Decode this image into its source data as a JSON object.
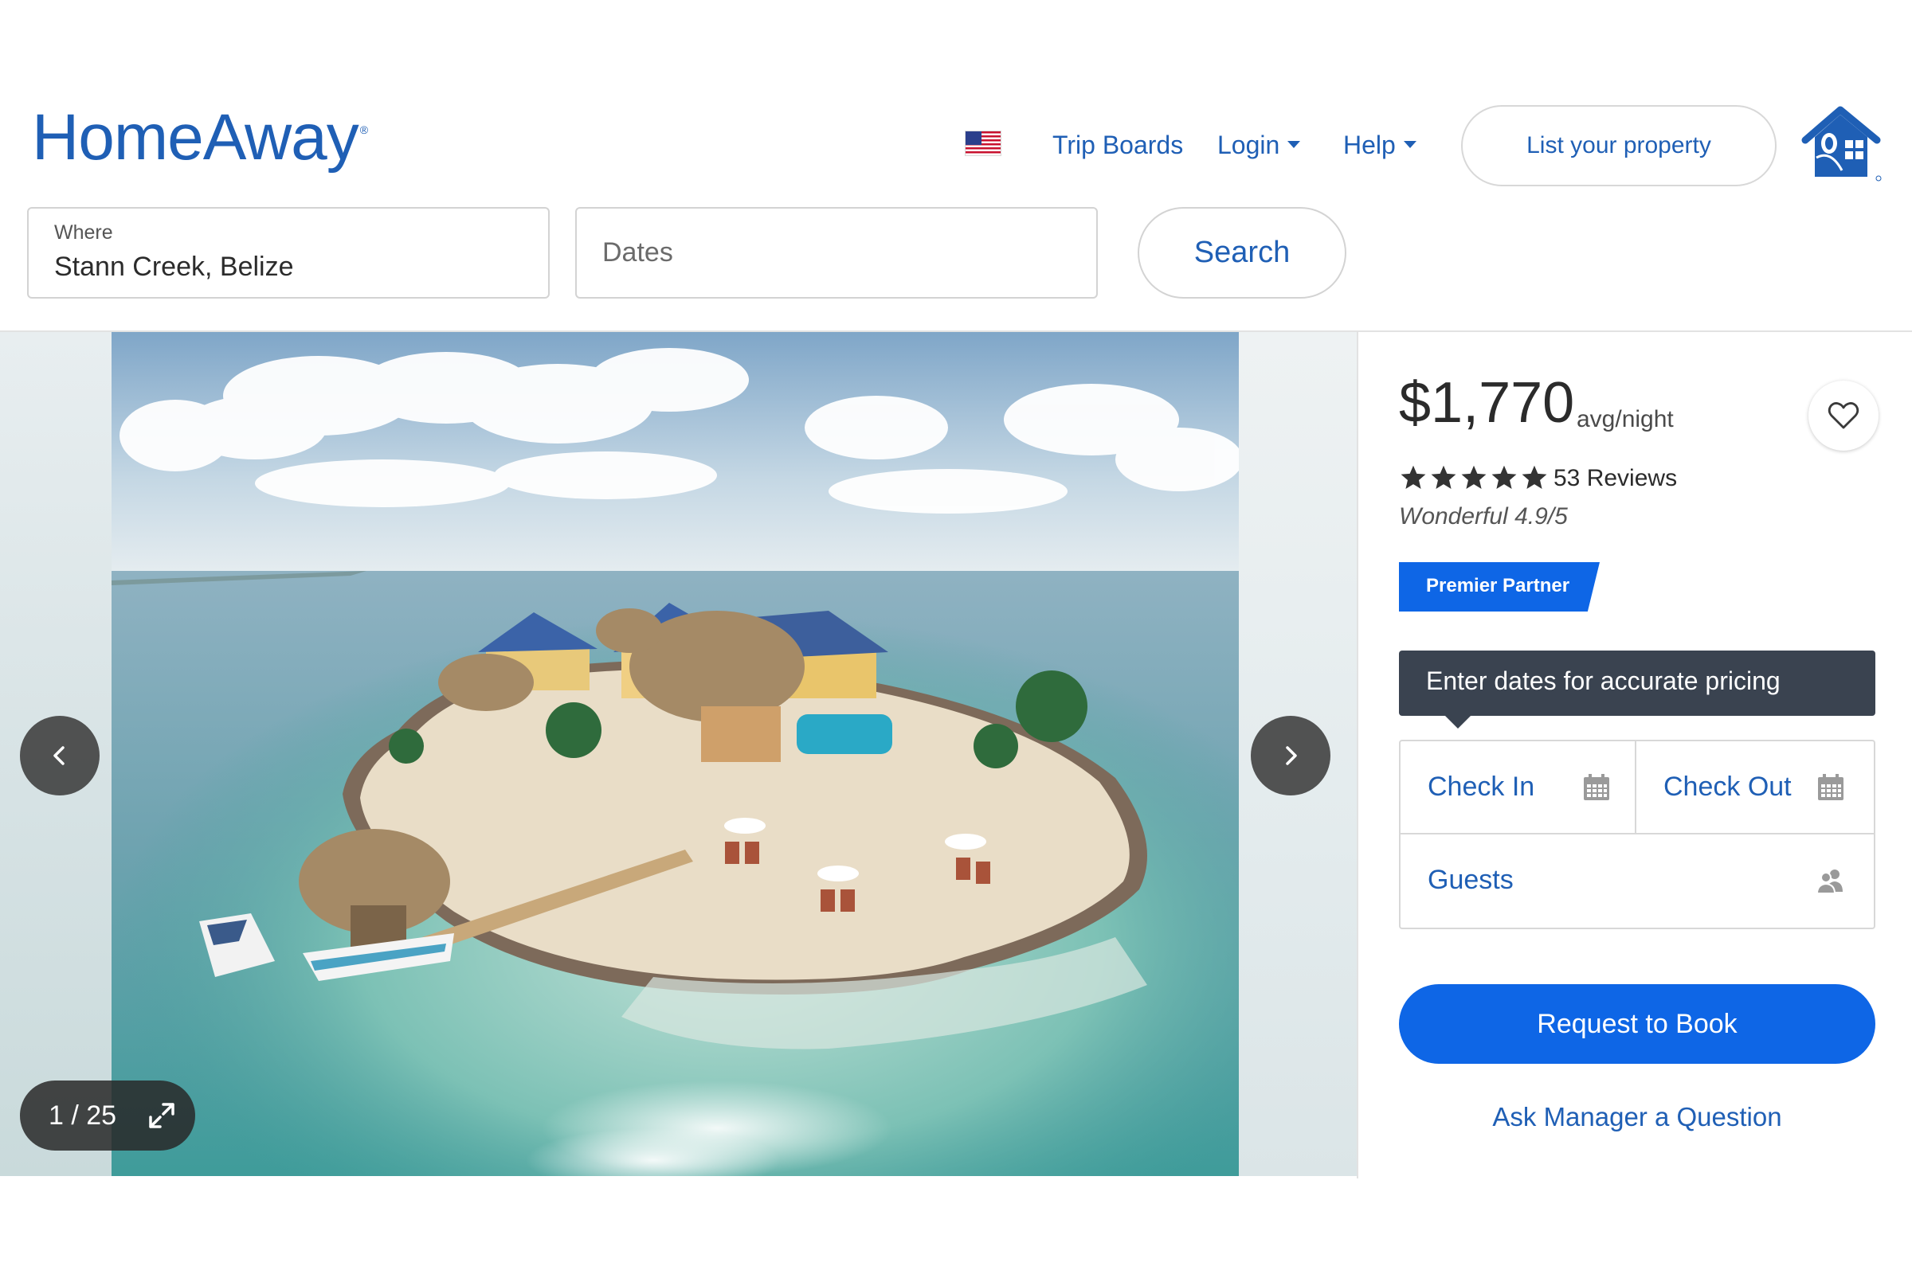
{
  "brand": {
    "name": "HomeAway",
    "mark": "®"
  },
  "nav": {
    "flag_icon": "us-flag-icon",
    "trip_boards": "Trip Boards",
    "login": "Login",
    "help": "Help",
    "list_property": "List your property",
    "house_icon": "homeaway-house-icon"
  },
  "search": {
    "where_label": "Where",
    "where_value": "Stann Creek, Belize",
    "dates_placeholder": "Dates",
    "button": "Search"
  },
  "gallery": {
    "current": "1",
    "separator": "/",
    "total": "25",
    "counter_text": "1 / 25",
    "prev_icon": "chevron-left-icon",
    "next_icon": "chevron-right-icon",
    "expand_icon": "expand-icon"
  },
  "listing": {
    "price": "$1,770",
    "price_unit": "avg/night",
    "stars": 5,
    "reviews": "53 Reviews",
    "rating": "Wonderful 4.9/5",
    "badge": "Premier Partner"
  },
  "booking": {
    "tooltip": "Enter dates for accurate pricing",
    "check_in": "Check In",
    "check_out": "Check Out",
    "guests": "Guests",
    "request_button": "Request to Book",
    "ask_link": "Ask Manager a Question"
  },
  "colors": {
    "brand_blue": "#1f5fb5",
    "action_blue": "#0e66e6",
    "tooltip_bg": "#3a4350"
  }
}
